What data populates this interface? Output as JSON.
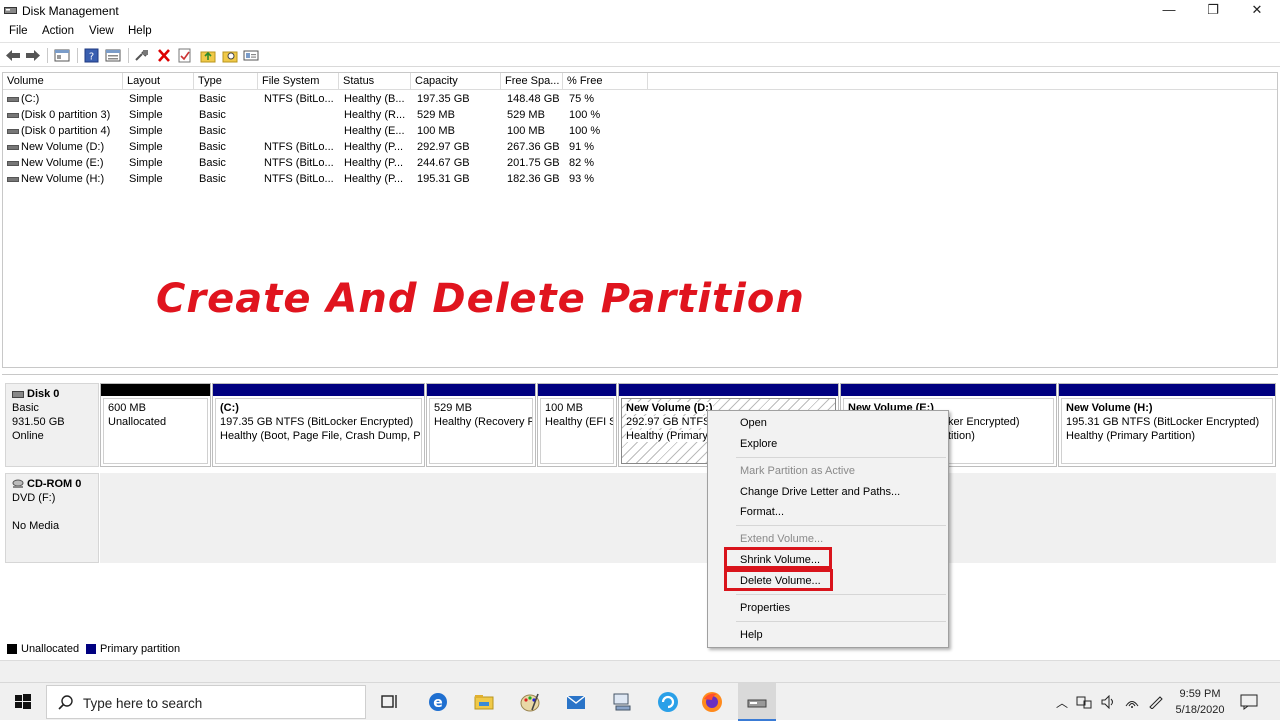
{
  "window": {
    "title": "Disk Management",
    "controls": {
      "minimize": "—",
      "restore": "❐",
      "close": "✕"
    }
  },
  "menu": [
    "File",
    "Action",
    "View",
    "Help"
  ],
  "toolbar_icons": [
    "back-arrow-icon",
    "forward-arrow-icon",
    "console-tree-icon",
    "help-icon",
    "properties-icon",
    "connect-icon",
    "delete-icon",
    "check-icon",
    "folder-up-icon",
    "folder-search-icon",
    "view-icon"
  ],
  "table": {
    "columns": [
      "Volume",
      "Layout",
      "Type",
      "File System",
      "Status",
      "Capacity",
      "Free Spa...",
      "% Free"
    ],
    "rows": [
      [
        "(C:)",
        "Simple",
        "Basic",
        "NTFS (BitLo...",
        "Healthy (B...",
        "197.35 GB",
        "148.48 GB",
        "75 %"
      ],
      [
        "(Disk 0 partition 3)",
        "Simple",
        "Basic",
        "",
        "Healthy (R...",
        "529 MB",
        "529 MB",
        "100 %"
      ],
      [
        "(Disk 0 partition 4)",
        "Simple",
        "Basic",
        "",
        "Healthy (E...",
        "100 MB",
        "100 MB",
        "100 %"
      ],
      [
        "New Volume (D:)",
        "Simple",
        "Basic",
        "NTFS (BitLo...",
        "Healthy (P...",
        "292.97 GB",
        "267.36 GB",
        "91 %"
      ],
      [
        "New Volume (E:)",
        "Simple",
        "Basic",
        "NTFS (BitLo...",
        "Healthy (P...",
        "244.67 GB",
        "201.75 GB",
        "82 %"
      ],
      [
        "New Volume (H:)",
        "Simple",
        "Basic",
        "NTFS (BitLo...",
        "Healthy (P...",
        "195.31 GB",
        "182.36 GB",
        "93 %"
      ]
    ]
  },
  "overlay_title": "Create And Delete Partition",
  "disk0": {
    "name": "Disk 0",
    "type": "Basic",
    "size": "931.50 GB",
    "state": "Online",
    "partitions": [
      {
        "title": "",
        "line1": "600 MB",
        "line2": "Unallocated"
      },
      {
        "title": "(C:)",
        "line1": "197.35 GB NTFS (BitLocker Encrypted)",
        "line2": "Healthy (Boot, Page File, Crash Dump, Pr"
      },
      {
        "title": "",
        "line1": "529 MB",
        "line2": "Healthy (Recovery P"
      },
      {
        "title": "",
        "line1": "100 MB",
        "line2": "Healthy (EFI S"
      },
      {
        "title": "New Volume  (D:)",
        "line1": "292.97 GB NTFS (",
        "line2": "Healthy (Primary"
      },
      {
        "title": "New Volume  (E:)",
        "line1": "ker Encrypted)",
        "line2": "tition)"
      },
      {
        "title": "New Volume  (H:)",
        "line1": "195.31 GB NTFS (BitLocker Encrypted)",
        "line2": "Healthy (Primary Partition)"
      }
    ]
  },
  "cdrom0": {
    "name": "CD-ROM 0",
    "drive": "DVD (F:)",
    "media": "No Media"
  },
  "legend": {
    "unallocated": "Unallocated",
    "primary": "Primary partition",
    "unallocated_color": "#000000",
    "primary_color": "#000080"
  },
  "context_menu": {
    "open": "Open",
    "explore": "Explore",
    "mark_active": "Mark Partition as Active",
    "change_letter": "Change Drive Letter and Paths...",
    "format": "Format...",
    "extend": "Extend Volume...",
    "shrink": "Shrink Volume...",
    "delete": "Delete Volume...",
    "properties": "Properties",
    "help": "Help"
  },
  "taskbar": {
    "search_placeholder": "Type here to search",
    "time": "9:59 PM",
    "date": "5/18/2020"
  },
  "colors": {
    "accent_red": "#e0141e",
    "primary_partition": "#000080"
  }
}
